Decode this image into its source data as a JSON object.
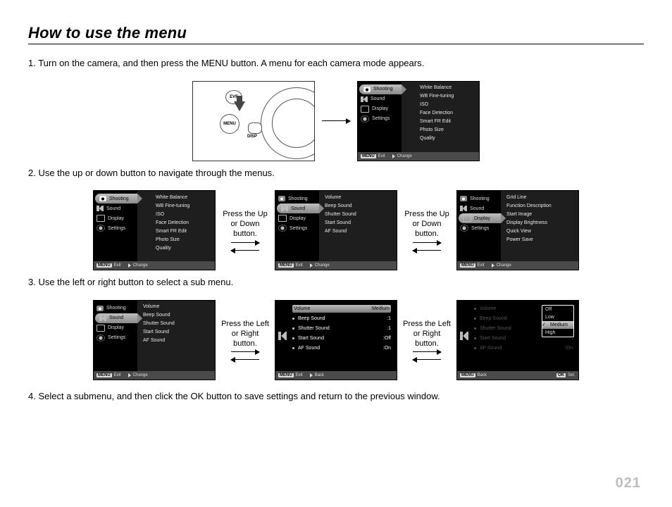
{
  "title": "How to use the menu",
  "page_number": "021",
  "steps": {
    "s1": "1. Turn on the camera, and then press the MENU button. A menu for each camera mode appears.",
    "s2": "2. Use the up or down button to navigate through the menus.",
    "s3": "3. Use the left or right button to select a sub menu.",
    "s4": "4. Select a submenu, and then click the OK button to save settings and return to the previous window."
  },
  "captions": {
    "updown": "Press the Up or Down button.",
    "leftright": "Press the Left or Right button."
  },
  "illus_labels": {
    "evf": "EVF",
    "menu": "MENU",
    "disp": "DISP"
  },
  "categories": {
    "shooting": "Shooting",
    "sound": "Sound",
    "display": "Display",
    "settings": "Settings"
  },
  "shooting_items": [
    "White Balance",
    "WB Fine-tuning",
    "ISO",
    "Face Detection",
    "Smart FR Edit",
    "Photo Size",
    "Quality"
  ],
  "sound_items": [
    "Volume",
    "Beep Sound",
    "Shutter Sound",
    "Start Sound",
    "AF Sound"
  ],
  "display_items": [
    "Grid Line",
    "Function Description",
    "Start Image",
    "Display Brightness",
    "Quick View",
    "Power Save"
  ],
  "volume_values": {
    "items": [
      "Volume",
      "Beep Sound",
      "Shutter Sound",
      "Start Sound",
      "AF Sound"
    ],
    "vals": [
      "Medium",
      "1",
      "1",
      "Off",
      "On"
    ]
  },
  "volume_options": [
    "Off",
    "Low",
    "Medium",
    "High"
  ],
  "footer": {
    "menu_key": "MENU",
    "exit": "Exit",
    "change": "Change",
    "back": "Back",
    "ok_key": "OK",
    "set": "Set"
  }
}
